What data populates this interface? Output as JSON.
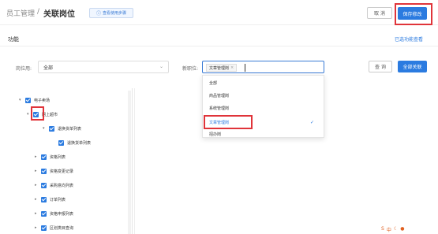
{
  "header": {
    "breadcrumb_parent": "员工管理",
    "breadcrumb_sep": "/",
    "breadcrumb_current": "关联岗位",
    "help_label": "查看使用步骤",
    "cancel_label": "取 消",
    "save_label": "保存修改"
  },
  "section": {
    "title": "功能",
    "selected_link": "已选功能查看"
  },
  "filters": {
    "position_label": "岗位用:",
    "position_value": "全部",
    "job_label": "新职位:",
    "job_tag": "文章管理岗",
    "query_label": "查 询",
    "expand_label": "全部关联"
  },
  "dropdown": {
    "options": [
      "全部",
      "商品管理岗",
      "系统管理岗",
      "文章管理岗",
      "招办岗"
    ],
    "selected_index": 3
  },
  "tree": {
    "items": [
      {
        "label": "电子卖场",
        "level": 0,
        "expanded": true
      },
      {
        "label": "网上超市",
        "level": 1,
        "expanded": true
      },
      {
        "label": "退换货单列表",
        "level": 2,
        "expanded": true
      },
      {
        "label": "退换货单列表",
        "level": 3,
        "expanded": false
      },
      {
        "label": "资格列表",
        "level": 2,
        "expanded": false
      },
      {
        "label": "资格变更记录",
        "level": 2,
        "expanded": false
      },
      {
        "label": "采购意向列表",
        "level": 2,
        "expanded": false
      },
      {
        "label": "订单列表",
        "level": 2,
        "expanded": false
      },
      {
        "label": "资格申报列表",
        "level": 2,
        "expanded": false
      },
      {
        "label": "区划类目查询",
        "level": 2,
        "expanded": false
      }
    ]
  },
  "colors": {
    "accent": "#2b7be0",
    "highlight": "#e0343a"
  }
}
